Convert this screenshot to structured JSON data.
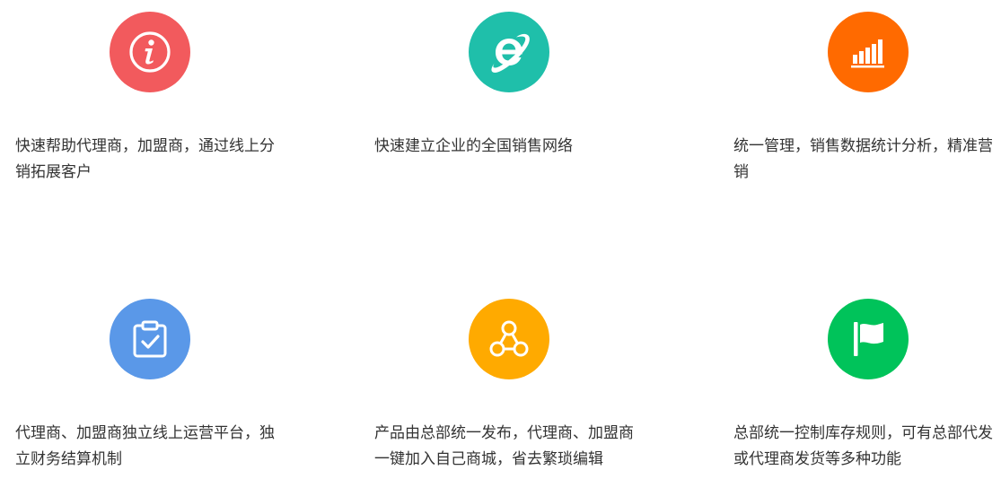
{
  "features": [
    {
      "icon": "info-icon",
      "color": "#f25a5d",
      "text": "快速帮助代理商，加盟商，通过线上分销拓展客户"
    },
    {
      "icon": "ie-browser-icon",
      "color": "#1fbfaa",
      "text": "快速建立企业的全国销售网络"
    },
    {
      "icon": "bar-chart-icon",
      "color": "#ff6a00",
      "text": "统一管理，销售数据统计分析，精准营销"
    },
    {
      "icon": "clipboard-check-icon",
      "color": "#5a98e8",
      "text": "代理商、加盟商独立线上运营平台，独立财务结算机制"
    },
    {
      "icon": "network-nodes-icon",
      "color": "#ffaa00",
      "text": "产品由总部统一发布，代理商、加盟商一键加入自己商城，省去繁琐编辑"
    },
    {
      "icon": "flag-icon",
      "color": "#00c35a",
      "text": "总部统一控制库存规则，可有总部代发或代理商发货等多种功能"
    }
  ]
}
